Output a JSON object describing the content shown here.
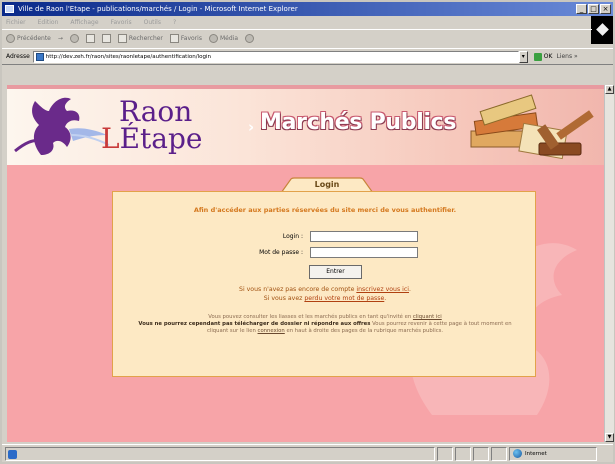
{
  "window": {
    "title": "Ville de Raon l'Etape - publications/marchés / Login - Microsoft Internet Explorer",
    "controls": [
      "_",
      "□",
      "×"
    ]
  },
  "menu": [
    "Fichier",
    "Edition",
    "Affichage",
    "Favoris",
    "Outils",
    "?"
  ],
  "toolbar": {
    "back": "Précédente",
    "forward": "→",
    "search": "Rechercher",
    "favorites": "Favoris",
    "media": "Média"
  },
  "address": {
    "label": "Adresse",
    "url": "http://dev.zeh.fr/raon/sites/raonletape/authentification/login",
    "go": "OK",
    "links": "Liens »"
  },
  "banner": {
    "brand_line1": "Raon",
    "brand_line2_prefix": "L",
    "brand_line2": "Étape",
    "section_arrow": "›",
    "section_title": "Marchés Publics"
  },
  "login": {
    "tab": "Login",
    "intro": "Afin d'accéder aux parties réservées du site merci de vous authentifier.",
    "login_label": "Login :",
    "password_label": "Mot de passe :",
    "submit": "Entrer",
    "no_account_prefix": "Si vous n'avez pas encore de compte",
    "no_account_link": "inscrivez vous ici",
    "no_account_suffix": ".",
    "lost_password_prefix": "Si vous avez",
    "lost_password_link": "perdu votre mot de passe",
    "lost_password_suffix": ".",
    "fine_1": "Vous pouvez consulter les liasses et les marchés publics en tant qu'invité en",
    "fine_1_link": "cliquant ici",
    "fine_2": "Vous ne pourrez cependant pas télécharger de dossier ni répondre aux offres",
    "fine_3": "Vous pourrez revenir à cette page à tout moment en cliquant sur le lien",
    "fine_3_link": "connexion",
    "fine_4": "en haut à droite des pages de la rubrique marchés publics."
  },
  "status": {
    "zone": "Internet"
  },
  "colors": {
    "page_bg": "#f7a4a8",
    "panel_bg": "#fde9c4",
    "panel_border": "#e2a24a",
    "intro_text": "#d4781e",
    "brand_purple": "#5b1f8a"
  }
}
